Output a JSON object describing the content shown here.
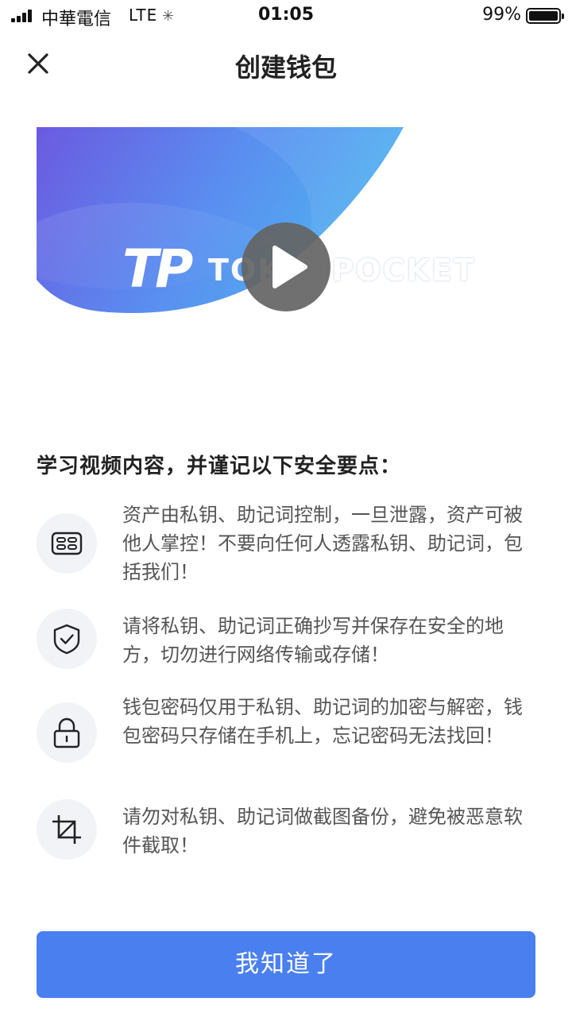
{
  "status_bar": {
    "carrier": "中華電信",
    "network": "LTE",
    "time": "01:05",
    "battery_percent": "99%",
    "battery_level": 0.99
  },
  "header": {
    "title": "创建钱包",
    "close_icon": "close-icon"
  },
  "video": {
    "brand_logo": "TP",
    "brand_name": "TOKENPOCKET",
    "play_icon": "play-icon"
  },
  "section_title": "学习视频内容，并谨记以下安全要点：",
  "tips": [
    {
      "icon": "mnemonic-grid-icon",
      "text": "资产由私钥、助记词控制，一旦泄露，资产可被他人掌控！不要向任何人透露私钥、助记词，包括我们！"
    },
    {
      "icon": "shield-check-icon",
      "text": "请将私钥、助记词正确抄写并保存在安全的地方，切勿进行网络传输或存储！"
    },
    {
      "icon": "lock-icon",
      "text": "钱包密码仅用于私钥、助记词的加密与解密，钱包密码只存储在手机上，忘记密码无法找回！"
    },
    {
      "icon": "crop-icon",
      "text": "请勿对私钥、助记词做截图备份，避免被恶意软件截取！"
    }
  ],
  "confirm_button": "我知道了",
  "colors": {
    "accent": "#4a7ff0",
    "banner_start": "#6b5ae0",
    "banner_end": "#4fb2f0",
    "icon_bg": "#f1f3f7"
  }
}
